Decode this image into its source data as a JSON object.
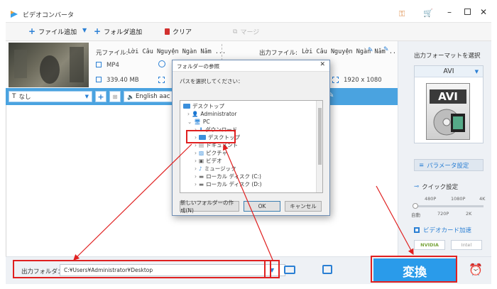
{
  "app": {
    "title": "ビデオコンバータ"
  },
  "toolbar": {
    "add_file": "ファイル追加",
    "add_folder": "フォルダ追加",
    "clear": "クリア",
    "merge": "マージ"
  },
  "file": {
    "source_label": "元ファイル:",
    "source_name": "Lời Câu Nguyện Ngàn Năm ...",
    "output_label": "出力ファイル:",
    "output_name": "Lời Câu Nguyện Ngàn Năm ...",
    "src_format": "MP4",
    "src_size": "339.40 MB",
    "out_resolution": "1920 x 1080"
  },
  "subbar": {
    "subtitle": "なし",
    "audio": "English aac C"
  },
  "right": {
    "title": "出力フォーマットを選択",
    "format": "AVI",
    "format_badge": "AVI",
    "param_button": "パラメータ設定",
    "quick_title": "クイック設定",
    "ticks_top": [
      "480P",
      "1080P",
      "4K"
    ],
    "ticks_bottom": [
      "自動",
      "720P",
      "2K"
    ],
    "gpu_title": "ビデオカード加速",
    "nvidia": "NVIDIA",
    "intel": "Intel"
  },
  "bottom": {
    "label": "出力フォルダ：",
    "path": "C:¥Users¥Administrator¥Desktop",
    "convert": "変換"
  },
  "dialog": {
    "title": "フォルダーの参照",
    "prompt": "パスを選択してください：",
    "tree": [
      "デスクトップ",
      "Administrator",
      "PC",
      "ダウンロード",
      "デスクトップ",
      "ドキュメント",
      "ピクチャ",
      "ビデオ",
      "ミュージック",
      "ローカル ディスク (C:)",
      "ローカル ディスク (D:)"
    ],
    "new_folder": "新しいフォルダーの作成(N)",
    "ok": "OK",
    "cancel": "キャンセル"
  },
  "colors": {
    "accent": "#4aa3e0",
    "convert": "#2a9bea",
    "highlight": "#e02020"
  }
}
